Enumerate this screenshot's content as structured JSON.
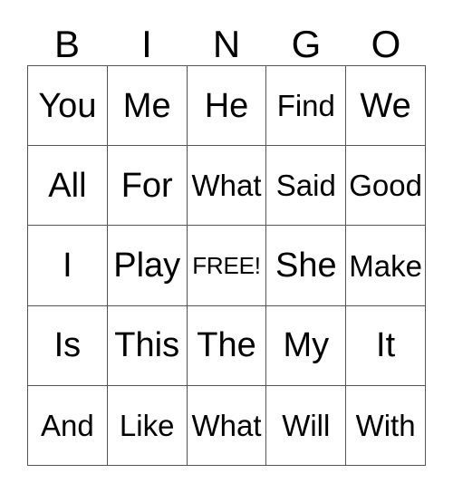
{
  "card": {
    "title": "BINGO",
    "header_letters": [
      "B",
      "I",
      "N",
      "G",
      "O"
    ],
    "free_space_label": "FREE!",
    "free_space_position": {
      "row": 3,
      "column": 3
    },
    "grid_size": "5x5",
    "colors": {
      "background": "#ffffff",
      "grid_line": "#555555",
      "text": "#000000"
    },
    "rows": [
      {
        "cells": [
          "You",
          "Me",
          "He",
          "Find",
          "We"
        ]
      },
      {
        "cells": [
          "All",
          "For",
          "What",
          "Said",
          "Good"
        ]
      },
      {
        "cells": [
          "I",
          "Play",
          "FREE!",
          "She",
          "Make"
        ]
      },
      {
        "cells": [
          "Is",
          "This",
          "The",
          "My",
          "It"
        ]
      },
      {
        "cells": [
          "And",
          "Like",
          "What",
          "Will",
          "With"
        ]
      }
    ]
  }
}
